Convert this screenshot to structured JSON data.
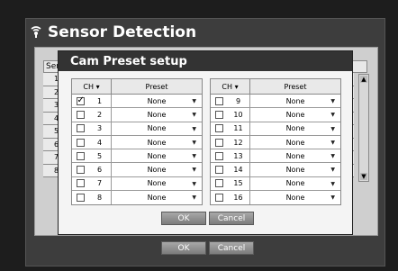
{
  "window": {
    "title": "Sensor Detection",
    "icon": "sensor-icon"
  },
  "background_table": {
    "header_partial": "Sen",
    "row_numbers": [
      "1",
      "2",
      "3",
      "4",
      "5",
      "6",
      "7",
      "8"
    ]
  },
  "modal": {
    "title": "Cam Preset setup",
    "left": {
      "header_ch": "CH",
      "header_preset": "Preset",
      "rows": [
        {
          "ch": "1",
          "preset": "None",
          "checked": true
        },
        {
          "ch": "2",
          "preset": "None",
          "checked": false
        },
        {
          "ch": "3",
          "preset": "None",
          "checked": false
        },
        {
          "ch": "4",
          "preset": "None",
          "checked": false
        },
        {
          "ch": "5",
          "preset": "None",
          "checked": false
        },
        {
          "ch": "6",
          "preset": "None",
          "checked": false
        },
        {
          "ch": "7",
          "preset": "None",
          "checked": false
        },
        {
          "ch": "8",
          "preset": "None",
          "checked": false
        }
      ]
    },
    "right": {
      "header_ch": "CH",
      "header_preset": "Preset",
      "rows": [
        {
          "ch": "9",
          "preset": "None",
          "checked": false
        },
        {
          "ch": "10",
          "preset": "None",
          "checked": false
        },
        {
          "ch": "11",
          "preset": "None",
          "checked": false
        },
        {
          "ch": "12",
          "preset": "None",
          "checked": false
        },
        {
          "ch": "13",
          "preset": "None",
          "checked": false
        },
        {
          "ch": "14",
          "preset": "None",
          "checked": false
        },
        {
          "ch": "15",
          "preset": "None",
          "checked": false
        },
        {
          "ch": "16",
          "preset": "None",
          "checked": false
        }
      ]
    },
    "ok_label": "OK",
    "cancel_label": "Cancel"
  },
  "footer": {
    "ok_label": "OK",
    "cancel_label": "Cancel"
  }
}
